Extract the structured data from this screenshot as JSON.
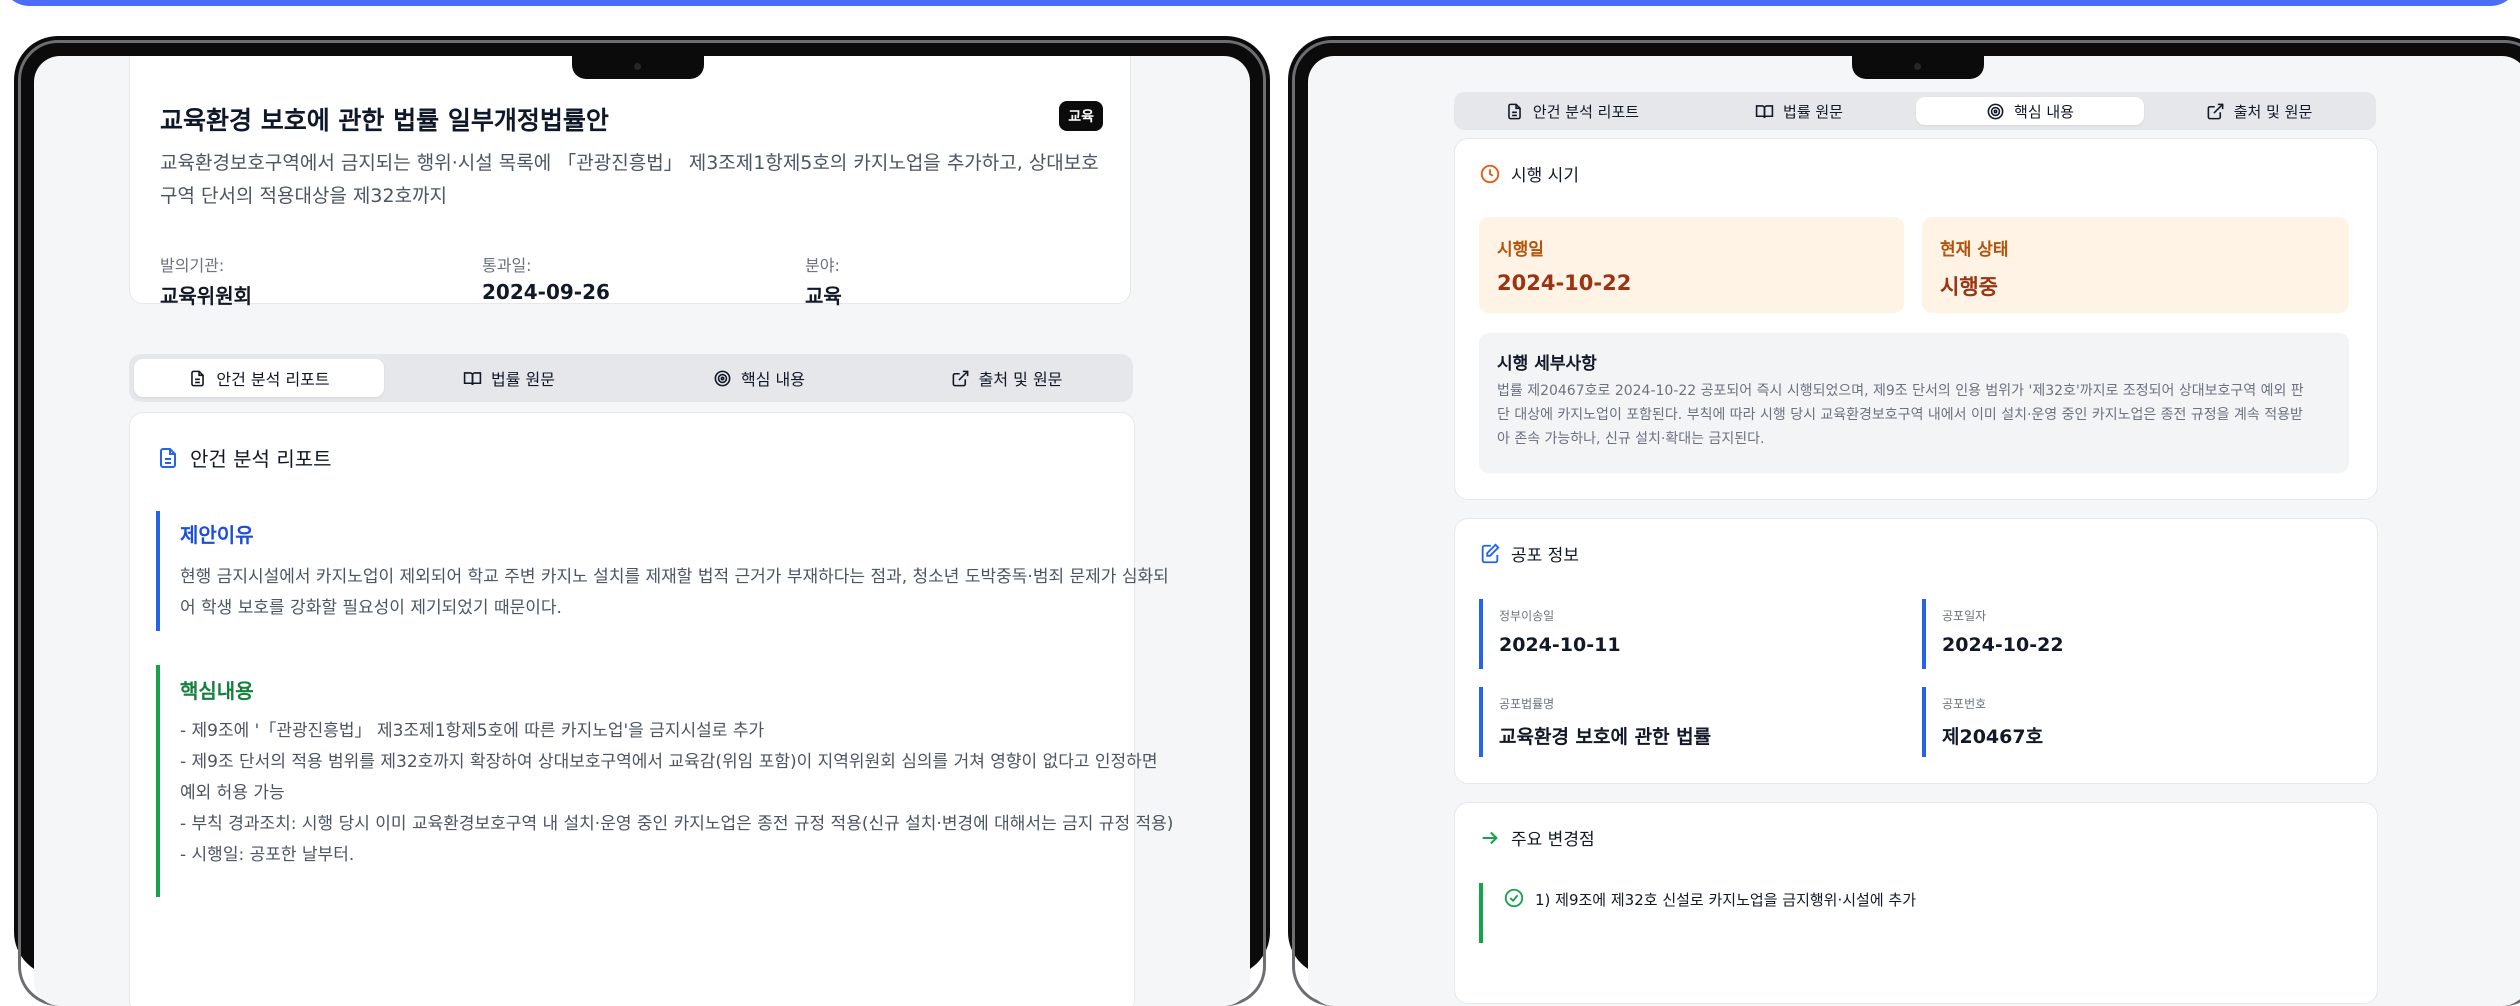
{
  "left": {
    "bill": {
      "title": "교육환경 보호에 관한 법률 일부개정법률안",
      "badge": "교육",
      "subtitle_line1": "교육환경보호구역에서 금지되는 행위·시설 목록에 「관광진흥법」 제3조제1항제5호의 카지노업을 추가하고, 상대보호",
      "subtitle_line2": "구역 단서의 적용대상을 제32호까지",
      "meta": [
        {
          "label": "발의기관:",
          "value": "교육위원회"
        },
        {
          "label": "통과일:",
          "value": "2024-09-26"
        },
        {
          "label": "분야:",
          "value": "교육"
        }
      ]
    },
    "tabs": [
      "안건 분석 리포트",
      "법률 원문",
      "핵심 내용",
      "출처 및 원문"
    ],
    "report": {
      "title": "안건 분석 리포트",
      "reason": {
        "title": "제안이유",
        "line1": "현행 금지시설에서 카지노업이 제외되어 학교 주변 카지노 설치를 제재할 법적 근거가 부재하다는 점과, 청소년 도박중독·범죄 문제가 심화되",
        "line2": "어 학생 보호를 강화할 필요성이 제기되었기 때문이다."
      },
      "core": {
        "title": "핵심내용",
        "lines": [
          "- 제9조에 '「관광진흥법」 제3조제1항제5호에 따른 카지노업'을 금지시설로 추가",
          "- 제9조 단서의 적용 범위를 제32호까지 확장하여 상대보호구역에서 교육감(위임 포함)이 지역위원회 심의를 거쳐 영향이 없다고 인정하면",
          "예외 허용 가능",
          "- 부칙 경과조치: 시행 당시 이미 교육환경보호구역 내 설치·운영 중인 카지노업은 종전 규정 적용(신규 설치·변경에 대해서는 금지 규정 적용)",
          "- 시행일: 공포한 날부터."
        ]
      }
    }
  },
  "right": {
    "tabs": [
      "안건 분석 리포트",
      "법률 원문",
      "핵심 내용",
      "출처 및 원문"
    ],
    "enforcement": {
      "title": "시행 시기",
      "date_label": "시행일",
      "date_value": "2024-10-22",
      "status_label": "현재 상태",
      "status_value": "시행중",
      "detail_title": "시행 세부사항",
      "detail_line1": "법률 제20467호로 2024-10-22 공포되어 즉시 시행되었으며, 제9조 단서의 인용 범위가 '제32호'까지로 조정되어 상대보호구역 예외 판",
      "detail_line2": "단 대상에 카지노업이 포함된다. 부칙에 따라 시행 당시 교육환경보호구역 내에서 이미 설치·운영 중인 카지노업은 종전 규정을 계속 적용받",
      "detail_line3": "아 존속 가능하나, 신규 설치·확대는 금지된다."
    },
    "promulgation": {
      "title": "공포 정보",
      "items": [
        {
          "label": "정부이송일",
          "value": "2024-10-11"
        },
        {
          "label": "공포일자",
          "value": "2024-10-22"
        },
        {
          "label": "공포법률명",
          "value": "교육환경 보호에 관한 법률"
        },
        {
          "label": "공포번호",
          "value": "제20467호"
        }
      ]
    },
    "changes": {
      "title": "주요 변경점",
      "first": "1) 제9조에 제32호 신설로 카지노업을 금지행위·시설에 추가"
    }
  },
  "colors": {
    "accent": "#4b6ef5",
    "reason_blue": "#2563eb",
    "core_green": "#16a34a",
    "status_orange": "#ea580c"
  }
}
